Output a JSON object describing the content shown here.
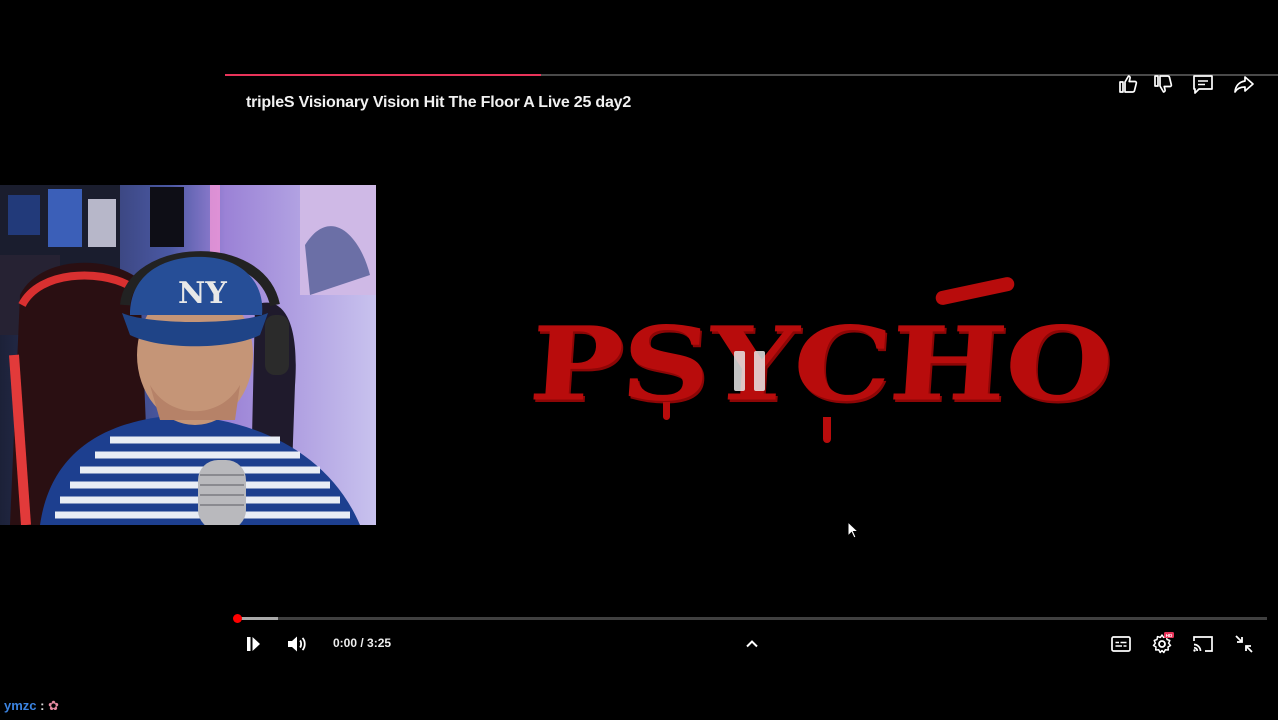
{
  "video": {
    "title": "tripleS Visionary Vision Hit The Floor A Live 25 day2",
    "overlay_text": "PSYCHO",
    "chapter_progress_fraction": 0.3,
    "playback_progress_fraction": 0.0,
    "buffer_fraction": 0.04,
    "time_current": "0:00",
    "time_separator": " / ",
    "time_total": "3:25",
    "state": "paused"
  },
  "actions": {
    "like_icon": "thumbs-up-icon",
    "dislike_icon": "thumbs-down-icon",
    "comments_icon": "comment-icon",
    "share_icon": "share-icon"
  },
  "controls": {
    "play_icon": "play-pause-icon",
    "volume_icon": "volume-icon",
    "expand_icon": "chevron-up-icon",
    "captions_icon": "captions-icon",
    "settings_icon": "gear-icon",
    "settings_badge": "HD",
    "cast_icon": "cast-icon",
    "exit_fullscreen_icon": "exit-fullscreen-icon"
  },
  "chat": {
    "username": "ymzc",
    "separator": " : ",
    "message_icon": "emote-icon"
  },
  "colors": {
    "accent_red": "#ff0000",
    "chapter_pink": "#e8345a",
    "psycho_red": "#b80c0c",
    "chat_user_blue": "#3b83e0"
  }
}
